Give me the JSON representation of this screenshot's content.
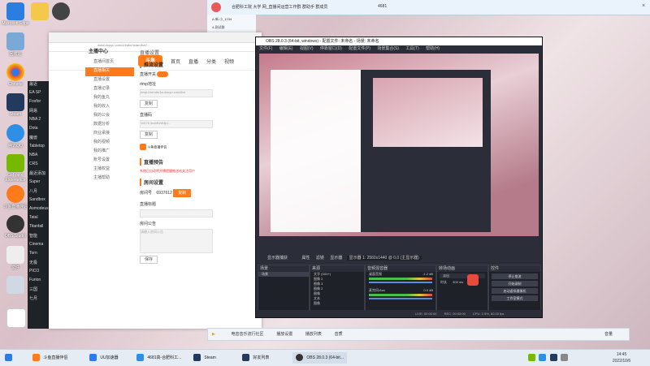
{
  "desktop": {
    "icons": [
      {
        "label": "Microsoft Edge",
        "color": "#2a7de1",
        "icon": "edge-icon"
      },
      {
        "label": "回收站",
        "color": "#7aa9d6",
        "icon": "recycle-bin-icon"
      },
      {
        "label": "Chrome",
        "color": "#e84b3c",
        "icon": "chrome-icon"
      },
      {
        "label": "Steam",
        "color": "#233a5e",
        "icon": "steam-icon"
      },
      {
        "label": "腾讯QQ",
        "color": "#2f8fe5",
        "icon": "qq-icon"
      },
      {
        "label": "GeForce Experience",
        "color": "#76b900",
        "icon": "nvidia-icon"
      },
      {
        "label": "斗鱼直播伴侣",
        "color": "#ff7a1a",
        "icon": "douyu-icon"
      },
      {
        "label": "OBS Studio",
        "color": "#333333",
        "icon": "obs-icon"
      },
      {
        "label": "文件",
        "color": "#eeeeee",
        "icon": "file-icon"
      }
    ],
    "left_list": [
      "最近",
      "EA SP",
      "Foxfor",
      "网易",
      "NBA 2",
      "Dota",
      "魔兽",
      "Tabletop",
      "NBA",
      "CRS",
      "最近添加",
      "Super",
      "八月",
      "Sandbox",
      "Asmodeus",
      "Tatal",
      "Titanfall",
      "智能",
      "Cinema",
      "Torn",
      "无极",
      "PICO",
      "Furion",
      "三国",
      "七月"
    ]
  },
  "chat_window": {
    "title": "合肥科工院 大学 网_直播间运营工作群 群助手 群成员",
    "count": "4681",
    "group_items": [
      "A-新 小_1234",
      "4-测试群"
    ]
  },
  "douyu": {
    "url": "www.douyu.com/creator/main/live/...",
    "logo": "斗鱼",
    "nav": [
      "首页",
      "直播",
      "分类",
      "视频"
    ],
    "side_header": "主播中心",
    "side_items": [
      "直播间首页",
      "直播相关",
      "直播设置",
      "直播记录",
      "我的鱼丸",
      "我的收入",
      "我的公会",
      "数据分析",
      "商业承接",
      "我的视频",
      "我的推广",
      "账号设置",
      "主播权益",
      "主播帮助"
    ],
    "active_item": "直播相关",
    "page_title": "直播设置",
    "sections": {
      "stream_settings": "推流设置",
      "live_notice": "直播预告",
      "room_settings": "房间设置"
    },
    "labels": {
      "enable_push": "直播开关",
      "rtmp_url": "rtmp地址",
      "stream_code": "直播码",
      "room_number": "房间号",
      "room_title": "直播标题",
      "announcement": "房间公告"
    },
    "values": {
      "rtmp_url": "rtmp://sendtc3a.douyu.com/live",
      "stream_code": "11576 0xzMUW4jU...",
      "room_number": "6937612",
      "copy": "复制",
      "save": "保存",
      "notice_hint": "斗鱼直播伴侣",
      "announcement_placeholder": "请输入房间公告",
      "warning": "系统已自动将开播提醒推送给关注用户"
    }
  },
  "obs": {
    "title": "OBS 28.0.3 (64-bit, windows) - 配置文件: 未命名 - 场景: 未命名",
    "menu": [
      "文件(F)",
      "编辑(E)",
      "视图(V)",
      "停靠窗口(D)",
      "配置文件(P)",
      "场景集合(S)",
      "工具(T)",
      "帮助(H)"
    ],
    "toolbar": {
      "source": "显示器捕获",
      "properties": "属性",
      "filters": "滤镜",
      "display": "显示器",
      "display_value": "显示器 1: 2560x1440 @ 0,0 (主显示器)"
    },
    "docks": {
      "scenes": {
        "title": "场景",
        "items": [
          "场景"
        ]
      },
      "sources": {
        "title": "来源",
        "items": [
          "文字 (GDI+)",
          "图像 2",
          "图像 3",
          "图像 2",
          "图像",
          "文本",
          "图像",
          "游戏捕获",
          "窗口捕获",
          "显示器捕获"
        ]
      },
      "mixer": {
        "title": "音频混音器",
        "items": [
          {
            "name": "桌面音频",
            "db": "-1.2 dB"
          },
          {
            "name": "麦克风/Aux",
            "db": "0.0 dB"
          }
        ]
      },
      "transitions": {
        "title": "转场动画",
        "fade": "淡出",
        "duration_label": "时长",
        "duration": "300 ms"
      },
      "controls": {
        "title": "控件",
        "buttons": [
          "停止推流",
          "开始录制",
          "启动虚拟摄像机",
          "工作室模式",
          "设置",
          "退出"
        ]
      }
    },
    "status": {
      "live": "LIVE: 00:00:00",
      "rec": "REC: 00:00:00",
      "cpu": "CPU: 2.5%, 60.00 fps"
    }
  },
  "media_bar": {
    "items": [
      "电音音乐流行社区",
      "播放设置",
      "播放列表",
      "音质"
    ],
    "right": "音量"
  },
  "taskbar": {
    "apps": [
      {
        "label": "斗鱼直播伴侣",
        "color": "#ff7a1a"
      },
      {
        "label": "UU加速器",
        "color": "#2b7ce9"
      },
      {
        "label": "4681高-合肥科工...",
        "color": "#2f8fe5"
      },
      {
        "label": "Steam",
        "color": "#233a5e"
      },
      {
        "label": "好友列表",
        "color": "#233a5e"
      },
      {
        "label": "OBS 28.0.3 (64-bit...",
        "color": "#333333"
      }
    ],
    "time": "14:45",
    "date": "2022/10/6"
  }
}
